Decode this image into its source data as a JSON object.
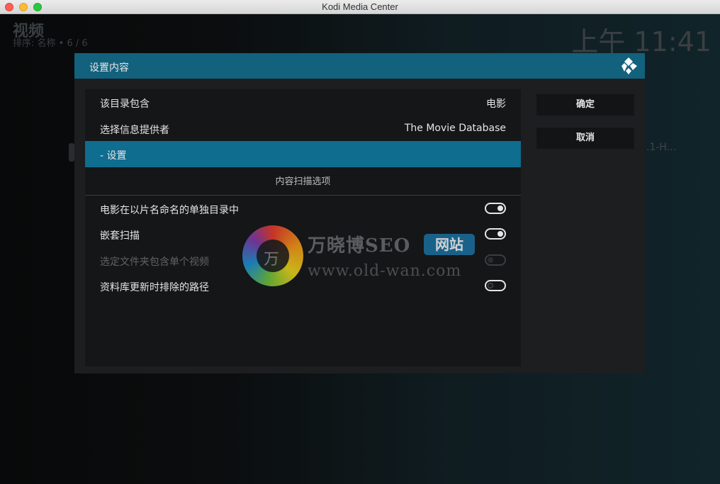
{
  "window": {
    "title": "Kodi Media Center"
  },
  "background": {
    "section_title": "视频",
    "sort_info": "排序: 名称  •  6 / 6",
    "clock": "上午 11:41",
    "truncated_item": ".1-H..."
  },
  "dialog": {
    "title": "设置内容",
    "rows": {
      "directory_contains": {
        "label": "该目录包含",
        "value": "电影"
      },
      "info_provider": {
        "label": "选择信息提供者",
        "value": "The Movie Database"
      },
      "settings": {
        "label": "- 设置"
      }
    },
    "scan_section_title": "内容扫描选项",
    "options": [
      {
        "label": "电影在以片名命名的单独目录中",
        "state": "on",
        "enabled": true
      },
      {
        "label": "嵌套扫描",
        "state": "on",
        "enabled": true
      },
      {
        "label": "选定文件夹包含单个视频",
        "state": "off",
        "enabled": false
      },
      {
        "label": "资料库更新时排除的路径",
        "state": "off",
        "enabled": true
      }
    ],
    "buttons": {
      "ok": "确定",
      "cancel": "取消"
    }
  },
  "watermark": {
    "glyph": "万",
    "text": "万晓博SEO",
    "badge": "网站",
    "url": "www.old-wan.com"
  },
  "colors": {
    "accent": "#12617d",
    "selected_row": "#0f6d8f",
    "panel": "#151618"
  }
}
